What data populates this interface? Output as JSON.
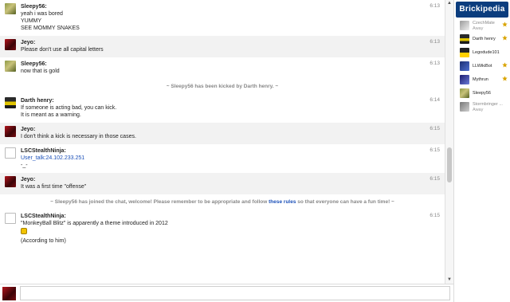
{
  "messages": [
    {
      "type": "msg",
      "alt": false,
      "avatar": "av-sleepy",
      "user": "Sleepy56:",
      "time": "6:13",
      "lines": [
        "yeah i was bored",
        "YUMMY",
        "SEE MOMMY SNAKES"
      ]
    },
    {
      "type": "msg",
      "alt": true,
      "avatar": "av-jeyo",
      "user": "Jeyo:",
      "time": "6:13",
      "lines": [
        "Please don't use all capital letters"
      ]
    },
    {
      "type": "msg",
      "alt": false,
      "avatar": "av-sleepy",
      "user": "Sleepy56:",
      "time": "6:13",
      "lines": [
        "now that is gold"
      ]
    },
    {
      "type": "alert",
      "text": "~ Sleepy56 has been kicked by Darth henry. ~"
    },
    {
      "type": "msg",
      "alt": false,
      "avatar": "av-darth",
      "user": "Darth henry:",
      "time": "6:14",
      "lines": [
        "If someone is acting bad, you can kick.",
        "It is meant as a warning."
      ]
    },
    {
      "type": "msg",
      "alt": true,
      "avatar": "av-jeyo",
      "user": "Jeyo:",
      "time": "6:15",
      "lines": [
        "I don't think a kick is necessary in those cases."
      ]
    },
    {
      "type": "msg",
      "alt": false,
      "avatar": "av-lsc",
      "user": "LSCStealthNinja:",
      "time": "6:15",
      "lines": [
        "User_talk:24.102.233.251",
        "-_-"
      ],
      "link_line": 0
    },
    {
      "type": "msg",
      "alt": true,
      "avatar": "av-jeyo",
      "user": "Jeyo:",
      "time": "6:15",
      "lines": [
        "It was a first time \"offense\""
      ]
    },
    {
      "type": "alert-rules",
      "before": "~ Sleepy56 has joined the chat, welcome! Please remember to be appropriate and follow ",
      "link": "these rules",
      "after": " so that everyone can have a fun time! ~"
    },
    {
      "type": "msg",
      "alt": false,
      "avatar": "av-lsc",
      "user": "LSCStealthNinja:",
      "time": "6:15",
      "lines": [
        "\"MonkeyBall Blitz\" is apparently a theme introduced in 2012",
        "",
        "(According to him)"
      ],
      "emote_line": 1
    }
  ],
  "sidebar": {
    "logo_text": "Brickipedia",
    "users": [
      {
        "name": "CzechMate",
        "status": "Away",
        "avatar": "av-czech",
        "mod": true,
        "away": true
      },
      {
        "name": "Darth henry",
        "status": "",
        "avatar": "av-darth",
        "mod": true,
        "away": false
      },
      {
        "name": "Legodude101",
        "status": "",
        "avatar": "av-lego",
        "mod": false,
        "away": false
      },
      {
        "name": "LLWikiBot",
        "status": "",
        "avatar": "av-llw",
        "mod": true,
        "away": false
      },
      {
        "name": "Mythrun",
        "status": "",
        "avatar": "av-myth",
        "mod": true,
        "away": false
      },
      {
        "name": "Sleepy56",
        "status": "",
        "avatar": "av-sleepy",
        "mod": false,
        "away": false
      },
      {
        "name": "Stormbringer ...",
        "status": "Away",
        "avatar": "av-storm",
        "mod": false,
        "away": true
      }
    ]
  },
  "input": {
    "placeholder": "",
    "value": ""
  },
  "colors": {
    "link": "#1a4fb8",
    "alt_row": "#f2f2f2",
    "mod_star": "#d9a400"
  }
}
